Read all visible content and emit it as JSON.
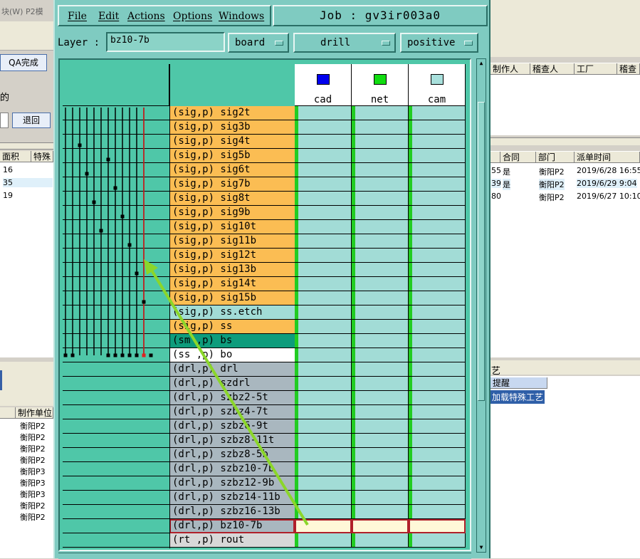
{
  "background": {
    "menu_fragment": "块(W)   P2模",
    "qa_button": "QA完成",
    "back_button": "退回",
    "left_label": "的",
    "left_table_headers": [
      "面积",
      "特殊"
    ],
    "left_table_rows": [
      "16",
      "35",
      "19"
    ],
    "bottom_left_header": "制作单位",
    "bottom_left_rows": [
      "衡阳P2",
      "衡阳P2",
      "衡阳P2",
      "衡阳P2",
      "衡阳P3",
      "衡阳P3",
      "衡阳P3",
      "衡阳P2",
      "衡阳P2"
    ],
    "right_top_headers": [
      "制作人",
      "稽查人",
      "工厂",
      "稽查"
    ],
    "right_mid_headers": [
      "合同",
      "部门",
      "派单时间"
    ],
    "right_mid_rows": [
      [
        "55",
        "是",
        "衡阳P2",
        "2019/6/28 16:55"
      ],
      [
        "39",
        "是",
        "衡阳P2",
        "2019/6/29 9:04"
      ],
      [
        "80",
        "",
        "衡阳P2",
        "2019/6/27 10:10"
      ]
    ],
    "right_bottom_label": "艺",
    "remind_header": "提醒",
    "remind_value": "加载特殊工艺"
  },
  "window": {
    "menu": [
      "File",
      "Edit",
      "Actions",
      "Options",
      "Windows"
    ],
    "job_title": "Job : gv3ir003a0",
    "layer_label": "Layer :",
    "layer_value": "bz10-7b",
    "dropdowns": [
      "board",
      "drill",
      "positive"
    ]
  },
  "columns": [
    {
      "label": "cad",
      "color": "#0000ee"
    },
    {
      "label": "net",
      "color": "#11dd11"
    },
    {
      "label": "cam",
      "color": "#a8e0dc"
    }
  ],
  "layers": [
    {
      "label": "(sig,p) sig2t",
      "bg": "#fbbd53"
    },
    {
      "label": "(sig,p) sig3b",
      "bg": "#fbbd53"
    },
    {
      "label": "(sig,p) sig4t",
      "bg": "#fbbd53"
    },
    {
      "label": "(sig,p) sig5b",
      "bg": "#fbbd53"
    },
    {
      "label": "(sig,p) sig6t",
      "bg": "#fbbd53"
    },
    {
      "label": "(sig,p) sig7b",
      "bg": "#fbbd53"
    },
    {
      "label": "(sig,p) sig8t",
      "bg": "#fbbd53"
    },
    {
      "label": "(sig,p) sig9b",
      "bg": "#fbbd53"
    },
    {
      "label": "(sig,p) sig10t",
      "bg": "#fbbd53"
    },
    {
      "label": "(sig,p) sig11b",
      "bg": "#fbbd53"
    },
    {
      "label": "(sig,p) sig12t",
      "bg": "#fbbd53"
    },
    {
      "label": "(sig,p) sig13b",
      "bg": "#fbbd53"
    },
    {
      "label": "(sig,p) sig14t",
      "bg": "#fbbd53"
    },
    {
      "label": "(sig,p) sig15b",
      "bg": "#fbbd53"
    },
    {
      "label": "(sig,p) ss.etch",
      "bg": "#a2dcd6"
    },
    {
      "label": "(sig,p) ss",
      "bg": "#fbbd53"
    },
    {
      "label": "(sm ,p) bs",
      "bg": "#0e9c7c"
    },
    {
      "label": "(ss ,p) bo",
      "bg": "#ffffff"
    },
    {
      "label": "(drl,p) drl",
      "bg": "#a9b7bf"
    },
    {
      "label": "(drl,p) szdrl",
      "bg": "#a9b7bf"
    },
    {
      "label": "(drl,p) szbz2-5t",
      "bg": "#a9b7bf"
    },
    {
      "label": "(drl,p) szbz4-7t",
      "bg": "#a9b7bf"
    },
    {
      "label": "(drl,p) szbz6-9t",
      "bg": "#a9b7bf"
    },
    {
      "label": "(drl,p) szbz8-11t",
      "bg": "#a9b7bf"
    },
    {
      "label": "(drl,p) szbz8-5b",
      "bg": "#a9b7bf"
    },
    {
      "label": "(drl,p) szbz10-7b",
      "bg": "#a9b7bf"
    },
    {
      "label": "(drl,p) szbz12-9b",
      "bg": "#a9b7bf"
    },
    {
      "label": "(drl,p) szbz14-11b",
      "bg": "#a9b7bf"
    },
    {
      "label": "(drl,p) szbz16-13b",
      "bg": "#a9b7bf"
    },
    {
      "label": "(drl,p) bz10-7b",
      "bg": "#a9b7bf"
    },
    {
      "label": "(rt ,p) rout",
      "bg": "#d8d8d8"
    }
  ],
  "selected_layer_index": 29,
  "annotation_color": "#8bd62a"
}
